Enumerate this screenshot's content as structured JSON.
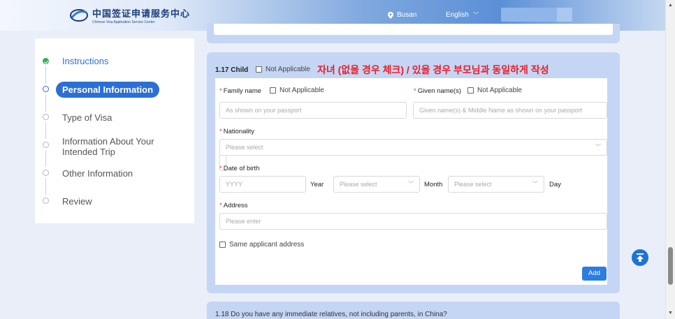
{
  "header": {
    "logo_cn": "中国签证申请服务中心",
    "logo_en": "Chinese Visa Application Service Center",
    "location": "Busan",
    "language": "English"
  },
  "sidebar": {
    "steps": [
      {
        "label": "Instructions",
        "state": "done"
      },
      {
        "label": "Personal Information",
        "state": "active"
      },
      {
        "label": "Type of Visa",
        "state": "pending"
      },
      {
        "label": "Information About Your Intended Trip",
        "state": "pending"
      },
      {
        "label": "Other Information",
        "state": "pending"
      },
      {
        "label": "Review",
        "state": "pending"
      }
    ]
  },
  "section": {
    "title": "1.17 Child",
    "not_applicable": "Not Applicable",
    "annotation": "자녀 (없을 경우 체크) / 있을 경우 부모님과 동일하게 작성"
  },
  "form": {
    "family_name_label": "Family name",
    "family_na": "Not Applicable",
    "family_placeholder": "As shown on your passport",
    "given_name_label": "Given name(s)",
    "given_na": "Not Applicable",
    "given_placeholder": "Given name(s) & Middle Name as shown on your passport",
    "nationality_label": "Nationality",
    "nationality_placeholder": "Please select",
    "dob_label": "Date of birth",
    "year_placeholder": "YYYY",
    "year_unit": "Year",
    "month_placeholder": "Please select",
    "month_unit": "Month",
    "day_placeholder": "Please select",
    "day_unit": "Day",
    "address_label": "Address",
    "address_placeholder": "Please enter",
    "same_address": "Same applicant address",
    "add_button": "Add"
  },
  "next_section": {
    "title": "1.18 Do you have any immediate relatives, not including parents, in China?"
  },
  "colors": {
    "primary": "#2b6fd6",
    "card_bg": "#c5d5f4",
    "annotation": "#ee1c25",
    "done": "#2fae53"
  }
}
